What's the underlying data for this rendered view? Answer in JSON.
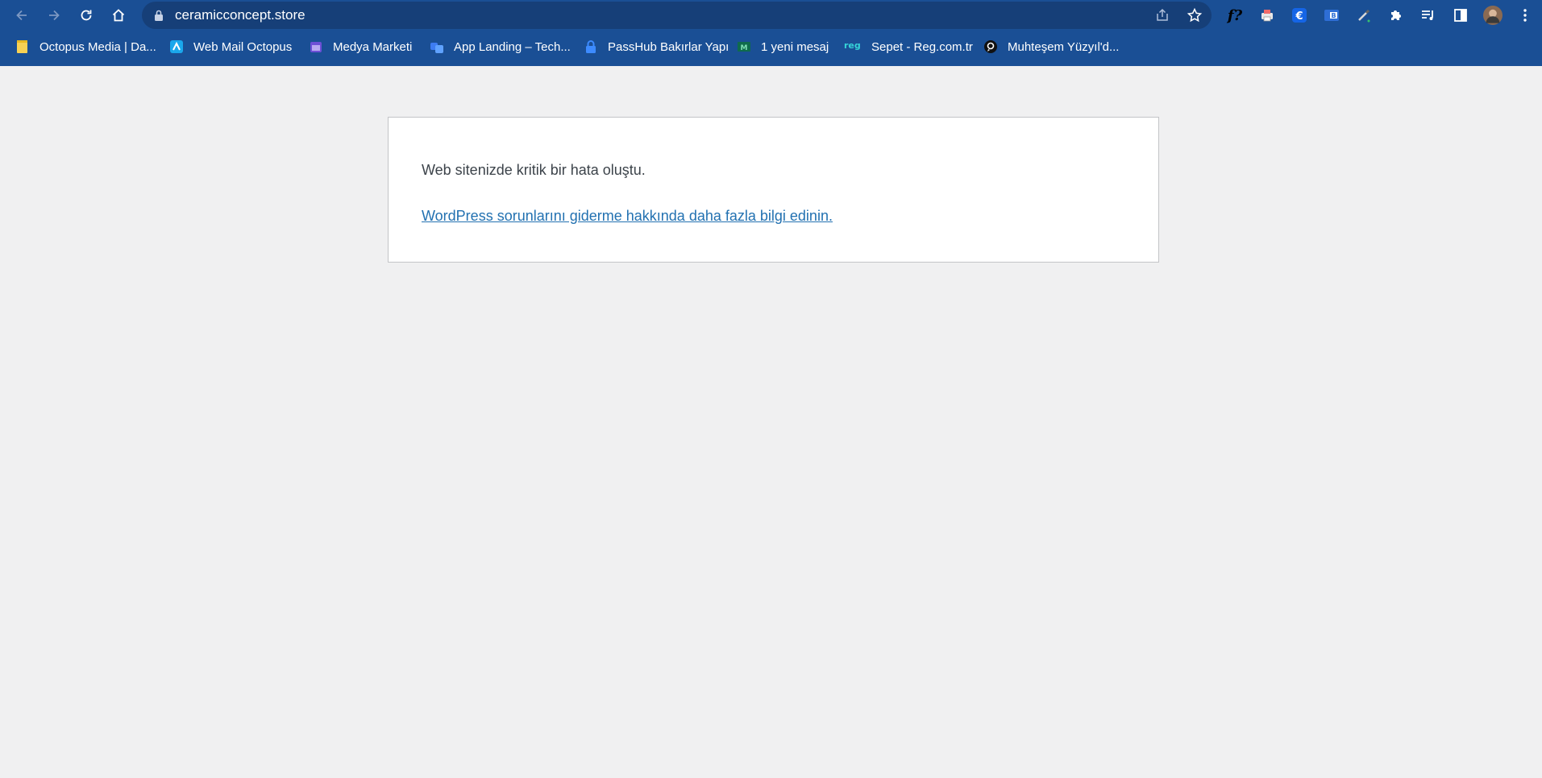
{
  "browser": {
    "url": "ceramicconcept.store",
    "accent": "#1a4f95",
    "omnibox_bg": "#163f78"
  },
  "bookmarks": [
    {
      "label": "Octopus Media | Da...",
      "icon": "note-icon"
    },
    {
      "label": "Web Mail Octopus",
      "icon": "webmail-icon"
    },
    {
      "label": "Medya Marketi",
      "icon": "calendar-icon"
    },
    {
      "label": "App Landing – Tech...",
      "icon": "app-icon"
    },
    {
      "label": "PassHub Bakırlar Yapı",
      "icon": "lock-icon"
    },
    {
      "label": "1 yeni mesaj",
      "icon": "message-icon"
    },
    {
      "label": "Sepet - Reg.com.tr",
      "icon": "reg-icon"
    },
    {
      "label": "Muhteşem Yüzyıl'd...",
      "icon": "chat-bubble-icon"
    }
  ],
  "page": {
    "error_message": "Web sitenizde kritik bir hata oluştu.",
    "help_link": "WordPress sorunlarını giderme hakkında daha fazla bilgi edinin.",
    "link_color": "#2271b1"
  }
}
